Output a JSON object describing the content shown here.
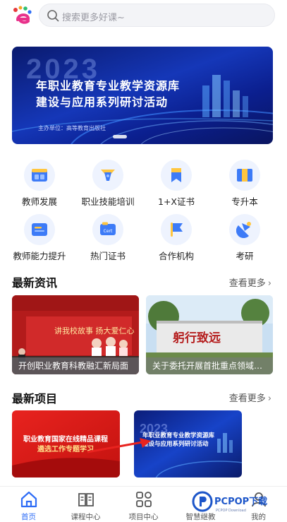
{
  "search": {
    "placeholder": "搜索更多好课~"
  },
  "banner": {
    "year": "2023",
    "line1": "年职业教育专业教学资源库",
    "line2": "建设与应用系列研讨活动",
    "sponsor": "主办单位：高等教育出版社"
  },
  "grid": [
    {
      "label": "教师发展",
      "icon": "teacher-development-icon"
    },
    {
      "label": "职业技能培训",
      "icon": "skills-training-icon"
    },
    {
      "label": "1+X证书",
      "icon": "certificate-bookmark-icon"
    },
    {
      "label": "专升本",
      "icon": "upgrade-book-icon"
    },
    {
      "label": "教师能力提升",
      "icon": "ability-card-icon"
    },
    {
      "label": "热门证书",
      "icon": "cert-card-icon"
    },
    {
      "label": "合作机构",
      "icon": "flag-icon"
    },
    {
      "label": "考研",
      "icon": "graduation-icon"
    }
  ],
  "news": {
    "title": "最新资讯",
    "more": "查看更多",
    "items": [
      {
        "caption": "开创职业教育科教融汇新局面",
        "image_text": "讲我校故事 扬大爱仁心"
      },
      {
        "caption": "关于委托开展首批重点领域…",
        "image_text": "躬行致远"
      }
    ]
  },
  "projects": {
    "title": "最新项目",
    "more": "查看更多",
    "items": [
      {
        "line1": "职业教育国家在线精品课程",
        "line2": "遴选工作专题学习"
      },
      {
        "year": "2023",
        "line1": "年职业教育专业教学资源库",
        "line2": "建设与应用系列研讨活动"
      }
    ]
  },
  "tabs": [
    {
      "label": "首页",
      "icon": "home-icon",
      "active": true
    },
    {
      "label": "课程中心",
      "icon": "open-book-icon",
      "active": false
    },
    {
      "label": "项目中心",
      "icon": "apps-grid-icon",
      "active": false
    },
    {
      "label": "智慧继教",
      "icon": "smart-icon",
      "active": false
    },
    {
      "label": "我的",
      "icon": "user-icon",
      "active": false
    }
  ],
  "watermark": {
    "brand": "PCPOP下载",
    "sub": "PCPOP Download"
  },
  "colors": {
    "accent": "#2f6df6",
    "icon_bg": "#eef3fe",
    "icon_blue": "#3d7bf7",
    "icon_yellow": "#ffc640"
  }
}
